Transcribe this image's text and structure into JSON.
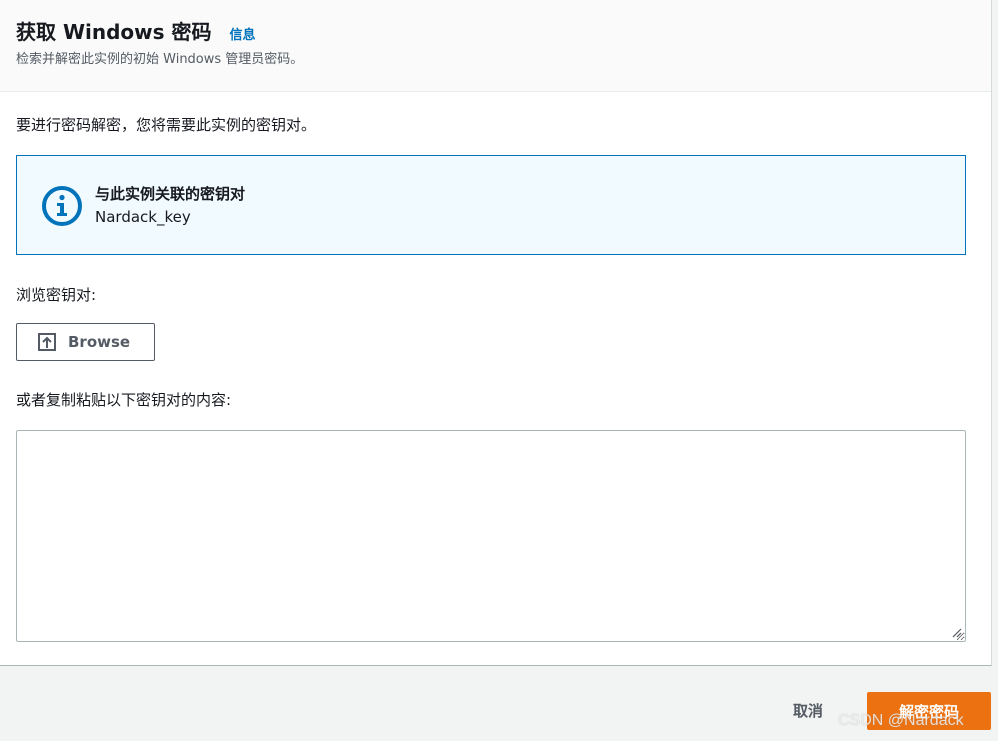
{
  "header": {
    "title": "获取 Windows 密码",
    "info_link": "信息",
    "subtitle": "检索并解密此实例的初始 Windows 管理员密码。"
  },
  "body": {
    "intro": "要进行密码解密，您将需要此实例的密钥对。",
    "alert": {
      "icon": "info-circle-icon",
      "title": "与此实例关联的密钥对",
      "value": "Nardack_key"
    },
    "browse_label": "浏览密钥对:",
    "browse_button": "Browse",
    "paste_label": "或者复制粘贴以下密钥对的内容:",
    "paste_value": ""
  },
  "footer": {
    "cancel": "取消",
    "submit": "解密密码"
  },
  "watermark": "CSDN @Nardack",
  "colors": {
    "accent": "#0073bb",
    "primary_button": "#ec7211",
    "alert_bg": "#f1faff"
  }
}
